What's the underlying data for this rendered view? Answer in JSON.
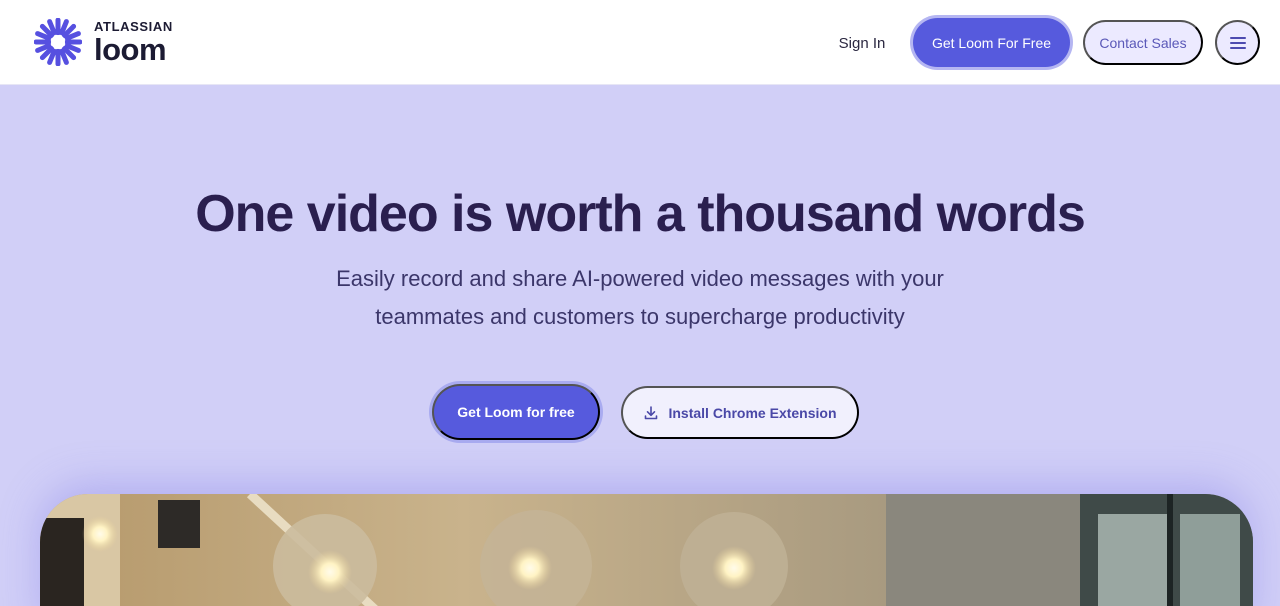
{
  "header": {
    "logo": {
      "company": "ATLASSIAN",
      "product": "loom",
      "icon": "loom-burst-icon",
      "color": "#5650e0"
    },
    "nav": {
      "sign_in": "Sign In",
      "get_loom": "Get Loom For Free",
      "contact_sales": "Contact Sales",
      "menu_icon": "hamburger-menu-icon"
    }
  },
  "hero": {
    "title": "One video is worth a thousand words",
    "subtitle_line1": "Easily record and share AI-powered video messages with your",
    "subtitle_line2": "teammates and customers to supercharge productivity",
    "primary_cta": "Get Loom for free",
    "secondary_cta": "Install Chrome Extension",
    "secondary_cta_icon": "download-icon"
  },
  "colors": {
    "accent": "#565add",
    "hero_background": "#d1cff7",
    "title": "#2a1f4f"
  }
}
